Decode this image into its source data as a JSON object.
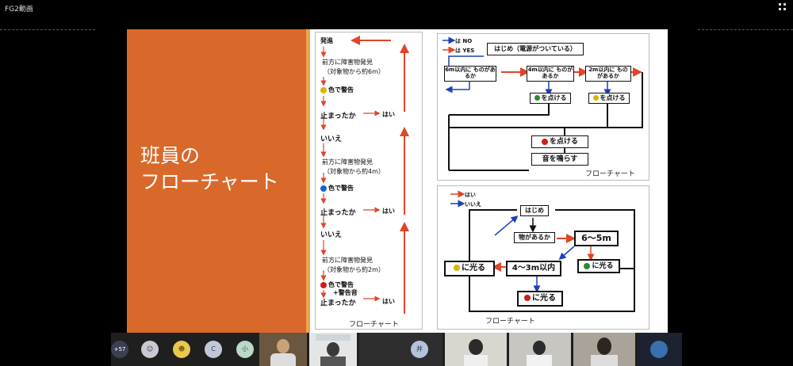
{
  "window": {
    "title": "FG2動画"
  },
  "slide": {
    "title_line1": "班員の",
    "title_line2": "フローチャート"
  },
  "left_chart": {
    "start": "発進",
    "step1": "前方に障害物発見",
    "step1_note": "（対象物から約6m）",
    "warn1": "色で警告",
    "stop_q1": "止まったか",
    "yes": "はい",
    "no1": "いいえ",
    "step2": "前方に障害物発見",
    "step2_note": "（対象物から約4m）",
    "warn2": "色で警告",
    "stop_q2": "止まったか",
    "no2": "いいえ",
    "step3": "前方に障害物発見",
    "step3_note": "（対象物から約2m）",
    "warn3": "色で警告",
    "warn3b": "+警告音",
    "stop_q3": "止まったか",
    "caption": "フローチャート"
  },
  "top_chart": {
    "legend_no": "は NO",
    "legend_yes": "は YES",
    "start": "はじめ（電源がついている）",
    "q6m": "6m以内に ものがあるか",
    "q4m": "4m以内に ものがあるか",
    "q2m": "2m以内に ものがあるか",
    "green": "を点ける",
    "yellow": "を点ける",
    "red": "を点ける",
    "sound": "音を鳴らす",
    "caption": "フローチャート"
  },
  "bottom_chart": {
    "legend_yes": "はい",
    "legend_no": "いいえ",
    "start": "はじめ",
    "q": "物があるか",
    "d65": "6〜5m",
    "green": "に光る",
    "d43": "4〜3m以内",
    "yellow": "に光る",
    "red": "に光る",
    "caption": "フローチャート"
  },
  "participants": {
    "more_count": "+57",
    "initials": [
      "C",
      "小",
      "井"
    ]
  },
  "colors": {
    "orange": "#d9692a",
    "red_arrow": "#e0452a",
    "blue_arrow": "#1d3fb8",
    "green_light": "#2f8a2f",
    "yellow_light": "#d9b400",
    "red_light": "#d21b1b"
  }
}
